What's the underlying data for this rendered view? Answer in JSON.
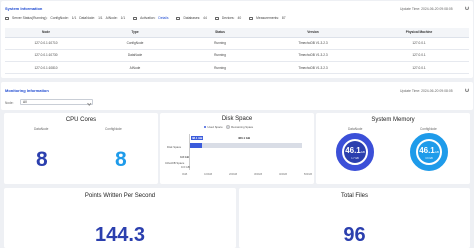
{
  "system": {
    "title": "System Information",
    "update_label": "Update Time:",
    "update_time": "2024-06-20 09:08:05",
    "server_status_label": "Server Status(Running):",
    "confignode_label": "ConfigNode:",
    "confignode_value": "1/1",
    "datanode_label": "DataNode:",
    "datanode_value": "1/1",
    "ainode_label": "AINode:",
    "ainode_value": "1/1",
    "activation_label": "Activation:",
    "activation_value": "Details",
    "databases_label": "Databases:",
    "databases_value": "44",
    "devices_label": "Devices:",
    "devices_value": "40",
    "measurements_label": "Measurements:",
    "measurements_value": "87"
  },
  "nodes_table": {
    "columns": [
      "Node",
      "Type",
      "Status",
      "Version",
      "Physical Machine"
    ],
    "rows": [
      [
        "127.0.0.1:10710",
        "ConfigNode",
        "Running",
        "TimechoDB V1.3.2.3",
        "127.0.0.1"
      ],
      [
        "127.0.0.1:10730",
        "DataNode",
        "Running",
        "TimechoDB V1.3.2.3",
        "127.0.0.1"
      ],
      [
        "127.0.0.1:10810",
        "AINode",
        "Running",
        "TimechoDB V1.3.2.3",
        "127.0.0.1"
      ]
    ]
  },
  "monitoring": {
    "title": "Monitoring Information",
    "update_label": "Update Time:",
    "update_time": "2024-06-20 09:08:05",
    "node_label": "Node:",
    "node_value": "All"
  },
  "cpu": {
    "title": "CPU Cores",
    "datanode_label": "DataNode",
    "confignode_label": "ConfigNode",
    "datanode_value": "8",
    "confignode_value": "8"
  },
  "disk": {
    "title": "Disk Space",
    "legend_used": "Used Space",
    "legend_remaining": "Remaining Space",
    "rows": [
      "Disk Space",
      "InfluxDB Space"
    ],
    "used_label": "38.1 GB",
    "remaining_label": "460.1 GB",
    "iot_label": "0.8 GB",
    "iot_sub": "0.0 GB",
    "ticks": [
      "0GB",
      "100GB",
      "200GB",
      "300GB",
      "400GB",
      "500GB"
    ],
    "used_color": "#3b5bdb",
    "remaining_color": "#d9dde6"
  },
  "memory": {
    "title": "System Memory",
    "datanode_label": "DataNode",
    "confignode_label": "ConfigNode",
    "datanode_value": "46.1",
    "datanode_unit": "GB",
    "datanode_sub": "1.7 GB",
    "confignode_value": "46.1",
    "confignode_unit": "GB",
    "confignode_sub": "3.9 GB",
    "datanode_color": "#3b4fd8",
    "confignode_color": "#1e9bea"
  },
  "points": {
    "title": "Points Written Per Second",
    "value": "144.3"
  },
  "files": {
    "title": "Total Files",
    "value": "96"
  },
  "colors": {
    "accent": "#1f4bd1",
    "big_number": "#2b3fae",
    "cpu_confignode": "#1e9bea"
  }
}
